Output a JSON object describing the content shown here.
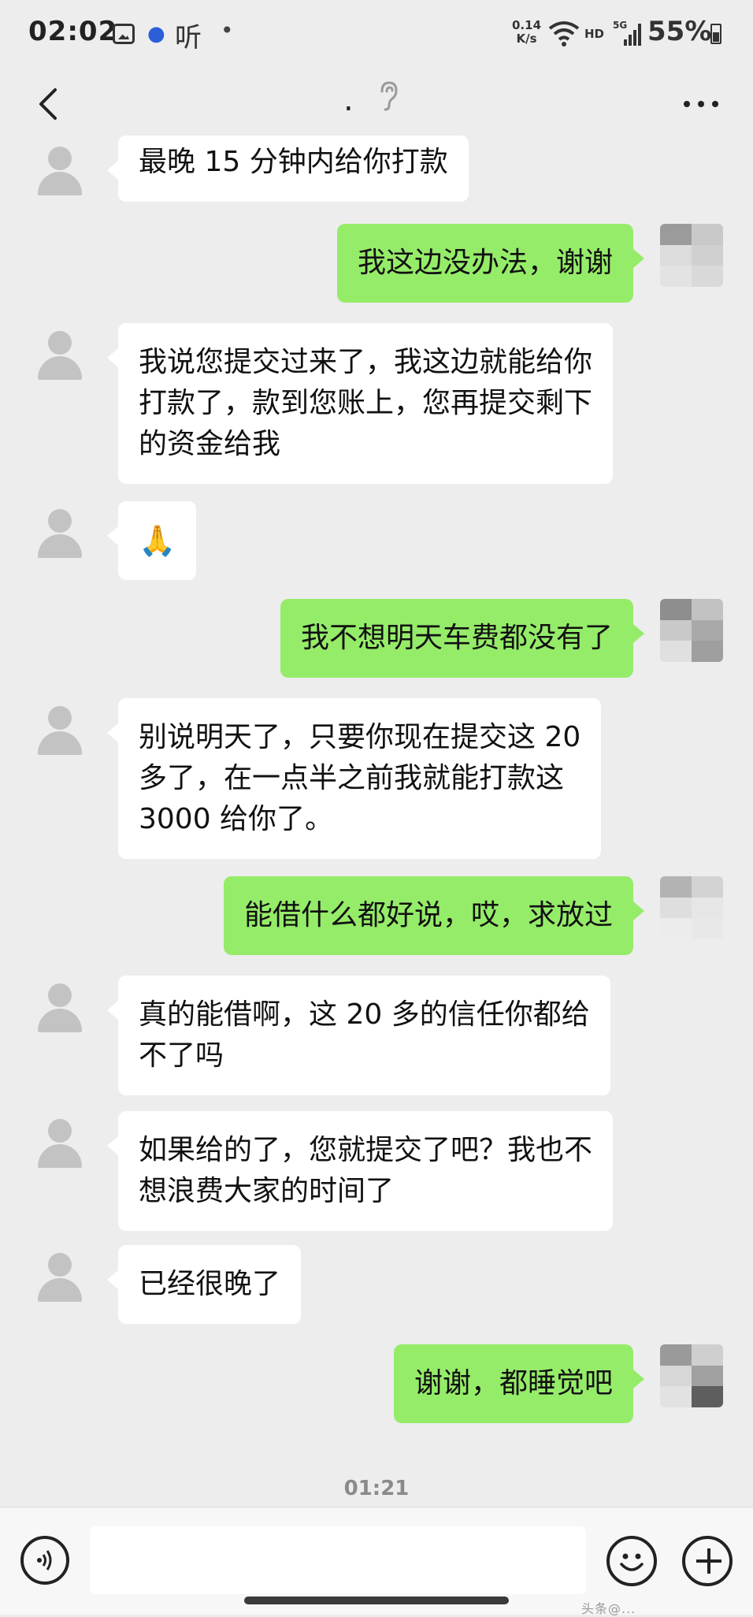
{
  "status_bar": {
    "time": "02:02",
    "app_icon": "听",
    "dot": "•",
    "net_speed_value": "0.14",
    "net_speed_unit": "K/s",
    "hd": "HD",
    "network": "5G",
    "battery": "55%"
  },
  "header": {
    "title": "."
  },
  "messages": [
    {
      "side": "in",
      "text": "最晚 15 分钟内给你打款"
    },
    {
      "side": "out",
      "text": "我这边没办法，谢谢"
    },
    {
      "side": "in",
      "text": "我说您提交过来了，我这边就能给你\n打款了，款到您账上，您再提交剩下\n的资金给我"
    },
    {
      "side": "in",
      "text": "🙏"
    },
    {
      "side": "out",
      "text": "我不想明天车费都没有了"
    },
    {
      "side": "in",
      "text": "别说明天了，只要你现在提交这 20\n多了，在一点半之前我就能打款这\n3000 给你了。"
    },
    {
      "side": "out",
      "text": "能借什么都好说，哎，求放过"
    },
    {
      "side": "in",
      "text": "真的能借啊，这 20 多的信任你都给\n不了吗"
    },
    {
      "side": "in",
      "text": "如果给的了，您就提交了吧？我也不\n想浪费大家的时间了"
    },
    {
      "side": "in",
      "text": "已经很晚了"
    },
    {
      "side": "out",
      "text": "谢谢，都睡觉吧"
    }
  ],
  "timestamp": "01:21",
  "watermark": "头条@..."
}
